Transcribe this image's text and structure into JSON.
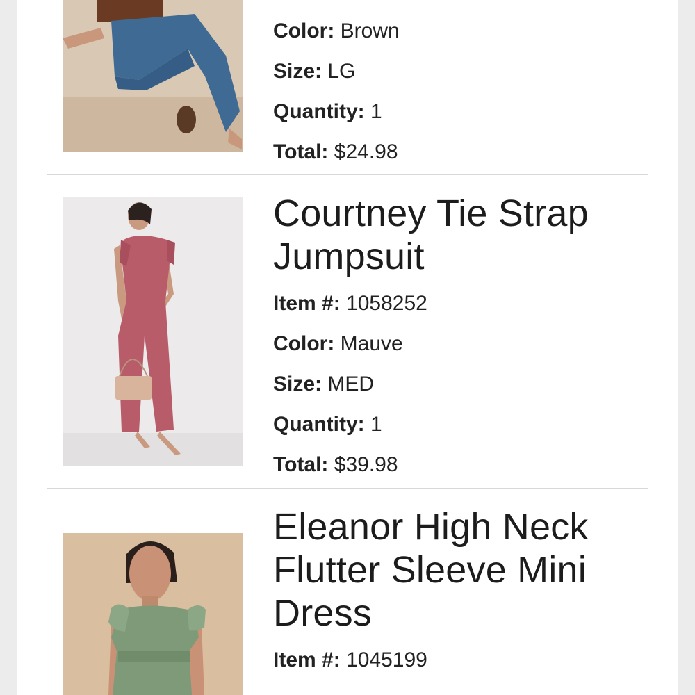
{
  "items": [
    {
      "name": "",
      "details": [
        {
          "label": "Color:",
          "value": "Brown"
        },
        {
          "label": "Size:",
          "value": "LG"
        },
        {
          "label": "Quantity:",
          "value": "1"
        },
        {
          "label": "Total:",
          "value": "$24.98"
        }
      ],
      "image_icon": "product-photo-jeans-outfit"
    },
    {
      "name": "Courtney Tie Strap Jumpsuit",
      "details": [
        {
          "label": "Item #:",
          "value": "1058252"
        },
        {
          "label": "Color:",
          "value": "Mauve"
        },
        {
          "label": "Size:",
          "value": "MED"
        },
        {
          "label": "Quantity:",
          "value": "1"
        },
        {
          "label": "Total:",
          "value": "$39.98"
        }
      ],
      "image_icon": "product-photo-mauve-jumpsuit"
    },
    {
      "name": "Eleanor High Neck Flutter Sleeve Mini Dress",
      "details": [
        {
          "label": "Item #:",
          "value": "1045199"
        }
      ],
      "image_icon": "product-photo-olive-dress"
    }
  ],
  "colors": {
    "page_bg": "#ffffff",
    "outer_bg": "#ececec",
    "divider": "#d8d8d8",
    "text": "#1a1a1a"
  }
}
